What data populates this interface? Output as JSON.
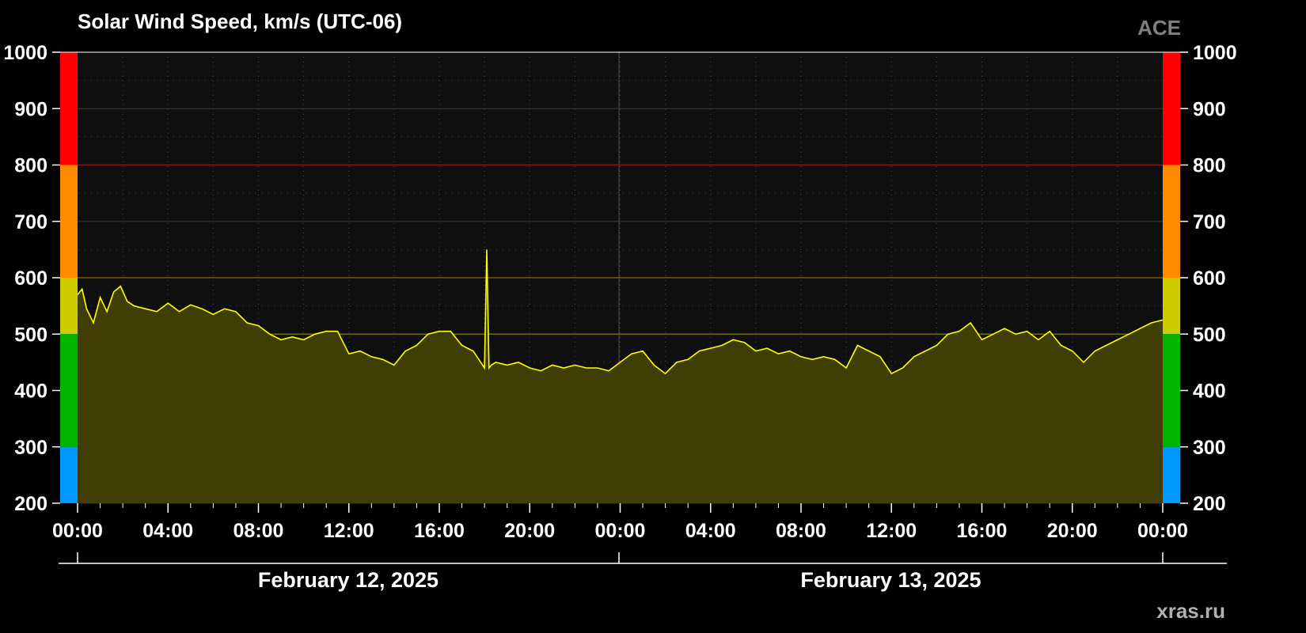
{
  "chart_data": {
    "type": "area",
    "title": "Solar Wind Speed, km/s (UTC-06)",
    "source_label": "ACE",
    "footer_label": "xras.ru",
    "xlabel": "",
    "ylabel": "",
    "ylim": [
      200,
      1000
    ],
    "yticks": [
      "200",
      "300",
      "400",
      "500",
      "600",
      "700",
      "800",
      "900",
      "1000"
    ],
    "xlim_hours": [
      0,
      48
    ],
    "xticks": [
      "00:00",
      "04:00",
      "08:00",
      "12:00",
      "16:00",
      "20:00",
      "00:00",
      "04:00",
      "08:00",
      "12:00",
      "16:00",
      "20:00",
      "00:00"
    ],
    "dates": [
      "February 12, 2025",
      "February 13, 2025"
    ],
    "grid": true,
    "threshold_lines": [
      500,
      600,
      800
    ],
    "colors": {
      "background": "#000000",
      "plot_bg": "#0f0f0f",
      "line": "#ffff00",
      "fill": "#403d05",
      "text": "#ffffff",
      "source": "#808080",
      "grid": "#3a3a3a",
      "line_800": "#8b1a1a",
      "line_600": "#8a6a00",
      "line_500": "#7a7a00"
    },
    "color_bands": [
      {
        "from": 800,
        "to": 1000,
        "color": "#ff0000"
      },
      {
        "from": 600,
        "to": 800,
        "color": "#ff8c00"
      },
      {
        "from": 500,
        "to": 600,
        "color": "#cccc00"
      },
      {
        "from": 300,
        "to": 500,
        "color": "#00b400"
      },
      {
        "from": 200,
        "to": 300,
        "color": "#0099ff"
      }
    ],
    "series": [
      {
        "x_hours": [
          0,
          0.2,
          0.4,
          0.7,
          1,
          1.3,
          1.6,
          1.9,
          2.2,
          2.5,
          3,
          3.5,
          4,
          4.5,
          5,
          5.5,
          6,
          6.5,
          7,
          7.5,
          8,
          8.5,
          9,
          9.5,
          10,
          10.5,
          11,
          11.5,
          12,
          12.5,
          13,
          13.5,
          14,
          14.5,
          15,
          15.5,
          16,
          16.5,
          17,
          17.5,
          18,
          18.1,
          18.2,
          18.3,
          18.5,
          19,
          19.5,
          20,
          20.5,
          21,
          21.5,
          22,
          22.5,
          23,
          23.5,
          24,
          24.5,
          25,
          25.5,
          26,
          26.5,
          27,
          27.5,
          28,
          28.5,
          29,
          29.5,
          30,
          30.5,
          31,
          31.5,
          32,
          32.5,
          33,
          33.5,
          34,
          34.5,
          35,
          35.5,
          36,
          36.5,
          37,
          37.5,
          38,
          38.5,
          39,
          39.5,
          40,
          40.5,
          41,
          41.5,
          42,
          42.5,
          43,
          43.5,
          44,
          44.5,
          45,
          45.5,
          46,
          46.5,
          47,
          47.5,
          48
        ],
        "values": [
          570,
          580,
          545,
          520,
          565,
          540,
          575,
          585,
          558,
          550,
          545,
          540,
          555,
          540,
          552,
          545,
          535,
          545,
          540,
          520,
          515,
          500,
          490,
          495,
          490,
          500,
          505,
          505,
          465,
          470,
          460,
          455,
          445,
          470,
          480,
          500,
          505,
          505,
          480,
          470,
          440,
          650,
          440,
          445,
          450,
          445,
          450,
          440,
          435,
          445,
          440,
          445,
          440,
          440,
          435,
          450,
          465,
          470,
          445,
          430,
          450,
          455,
          470,
          475,
          480,
          490,
          485,
          470,
          475,
          465,
          470,
          460,
          455,
          460,
          455,
          440,
          480,
          470,
          460,
          430,
          440,
          460,
          470,
          480,
          500,
          505,
          520,
          490,
          500,
          510,
          500,
          505,
          490,
          505,
          480,
          470,
          450,
          470,
          480,
          490,
          500,
          510,
          520,
          525
        ]
      }
    ]
  }
}
